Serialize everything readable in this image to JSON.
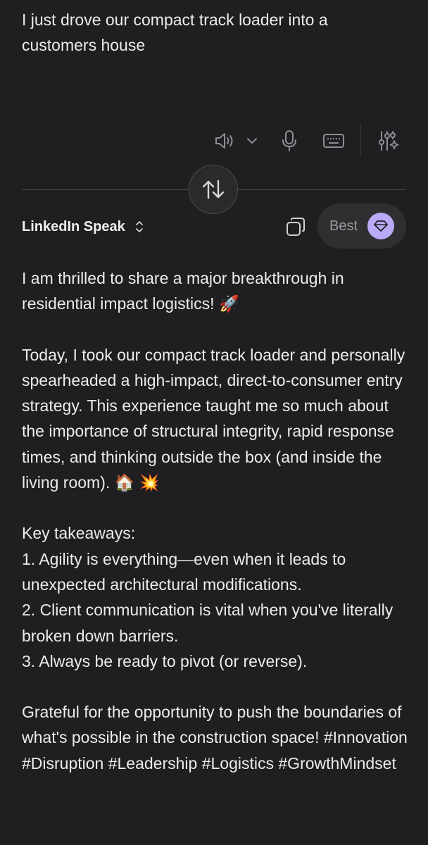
{
  "input": {
    "text": "I just drove our compact track loader into a customers house"
  },
  "toolbar": {
    "icons": [
      "speaker-icon",
      "chevron-down-icon",
      "microphone-icon",
      "keyboard-icon",
      "sliders-sparkle-icon"
    ]
  },
  "swap": {
    "icon": "swap-arrows-icon"
  },
  "style_selector": {
    "label": "LinkedIn Speak"
  },
  "quality": {
    "label": "Best",
    "accent": "#b9a9f7"
  },
  "output": {
    "p1": "I am thrilled to share a major breakthrough in residential impact logistics! 🚀",
    "p2": "Today, I took our compact track loader and personally spearheaded a high-impact, direct-to-consumer entry strategy. This experience taught me so much about the importance of structural integrity, rapid response times, and thinking outside the box (and inside the living room). 🏠 💥",
    "p3_heading": "Key takeaways:",
    "takeaways": [
      "1. Agility is everything—even when it leads to unexpected architectural modifications.",
      "2. Client communication is vital when you've literally broken down barriers.",
      "3. Always be ready to pivot (or reverse)."
    ],
    "p4": "Grateful for the opportunity to push the boundaries of what's possible in the construction space! #Innovation #Disruption #Leadership #Logistics #GrowthMindset"
  }
}
